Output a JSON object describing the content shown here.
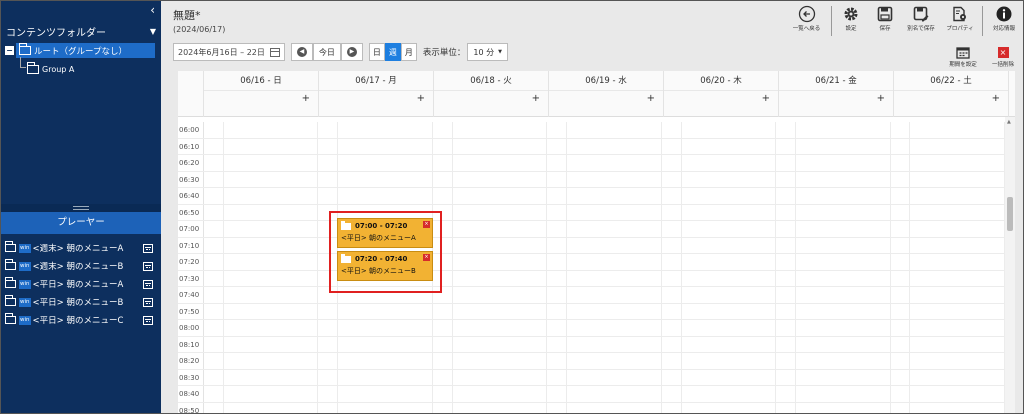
{
  "sidebar": {
    "folder_header": "コンテンツフォルダー",
    "tree": {
      "root": "ルート（グループなし）",
      "children": [
        "Group A"
      ]
    },
    "player_header": "プレーヤー",
    "players": [
      {
        "badge": "win",
        "label": "<週末> 朝のメニューA"
      },
      {
        "badge": "win",
        "label": "<週末> 朝のメニューB"
      },
      {
        "badge": "win",
        "label": "<平日> 朝のメニューA"
      },
      {
        "badge": "win",
        "label": "<平日> 朝のメニューB"
      },
      {
        "badge": "win",
        "label": "<平日> 朝のメニューC"
      }
    ]
  },
  "header": {
    "title": "無題*",
    "subtitle": "(2024/06/17)"
  },
  "toolbar": {
    "back": "一覧へ戻る",
    "settings": "設定",
    "save": "保存",
    "save_as": "別名で保存",
    "properties": "プロパティ",
    "info": "対応情報"
  },
  "controls": {
    "date_range": "2024年6月16日 – 22日",
    "today": "今日",
    "view_day": "日",
    "view_week": "週",
    "view_month": "月",
    "unit_label": "表示単位：",
    "unit_value": "10 分"
  },
  "actions": {
    "set_period": "期間を設定",
    "delete_all": "一括削除"
  },
  "calendar": {
    "days": [
      "06/16 - 日",
      "06/17 - 月",
      "06/18 - 火",
      "06/19 - 水",
      "06/20 - 木",
      "06/21 - 金",
      "06/22 - 土"
    ],
    "add_symbol": "+",
    "times": [
      "06:00",
      "06:10",
      "06:20",
      "06:30",
      "06:40",
      "06:50",
      "07:00",
      "07:10",
      "07:20",
      "07:30",
      "07:40",
      "07:50",
      "08:00",
      "08:10",
      "08:20",
      "08:30",
      "08:40",
      "08:50"
    ],
    "events": [
      {
        "time": "07:00 - 07:20",
        "label": "<平日> 朝のメニューA",
        "color": "#f2b233"
      },
      {
        "time": "07:20 - 07:40",
        "label": "<平日> 朝のメニューB",
        "color": "#f2b233"
      }
    ]
  },
  "colors": {
    "sidebar_bg": "#0d2f5e",
    "selected": "#1e6cc8",
    "accent": "#1e7fe0",
    "event": "#f2b233",
    "highlight": "#e02020"
  }
}
